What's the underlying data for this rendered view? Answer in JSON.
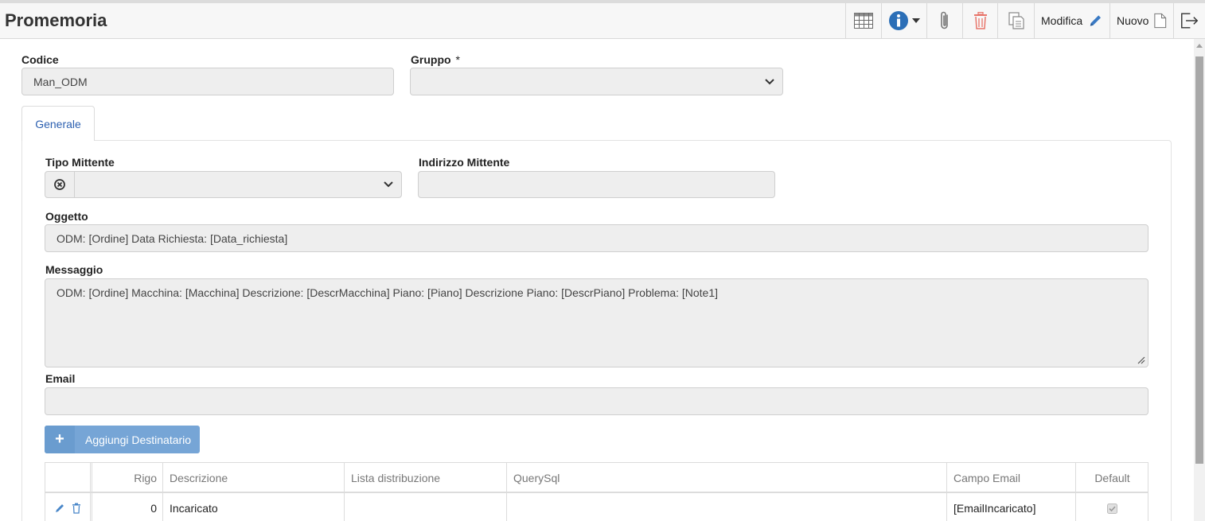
{
  "header": {
    "title": "Promemoria",
    "edit_label": "Modifica",
    "new_label": "Nuovo"
  },
  "form": {
    "codice_label": "Codice",
    "codice_value": "Man_ODM",
    "gruppo_label": "Gruppo",
    "gruppo_required": "*",
    "gruppo_value": ""
  },
  "tabs": [
    {
      "label": "Generale"
    }
  ],
  "generale": {
    "tipo_mittente_label": "Tipo Mittente",
    "tipo_mittente_value": "",
    "indirizzo_mittente_label": "Indirizzo Mittente",
    "indirizzo_mittente_value": "",
    "oggetto_label": "Oggetto",
    "oggetto_value": "ODM: [Ordine] Data Richiesta: [Data_richiesta]",
    "messaggio_label": "Messaggio",
    "messaggio_value": "ODM: [Ordine] Macchina: [Macchina] Descrizione: [DescrMacchina] Piano: [Piano] Descrizione Piano: [DescrPiano] Problema: [Note1]",
    "email_label": "Email",
    "email_value": "",
    "add_recipient_label": "Aggiungi Destinatario"
  },
  "grid": {
    "columns": [
      "Rigo",
      "Descrizione",
      "Lista distribuzione",
      "QuerySql",
      "Campo Email",
      "Default"
    ],
    "rows": [
      {
        "rigo": "0",
        "descrizione": "Incaricato",
        "lista": "",
        "query": "",
        "campo_email": "[EmailIncaricato]",
        "default": true
      }
    ]
  },
  "colors": {
    "accent": "#2b5fb0",
    "add_button": "#76a5d6",
    "delete_icon": "#e8756a",
    "field_bg": "#eeeeee"
  }
}
